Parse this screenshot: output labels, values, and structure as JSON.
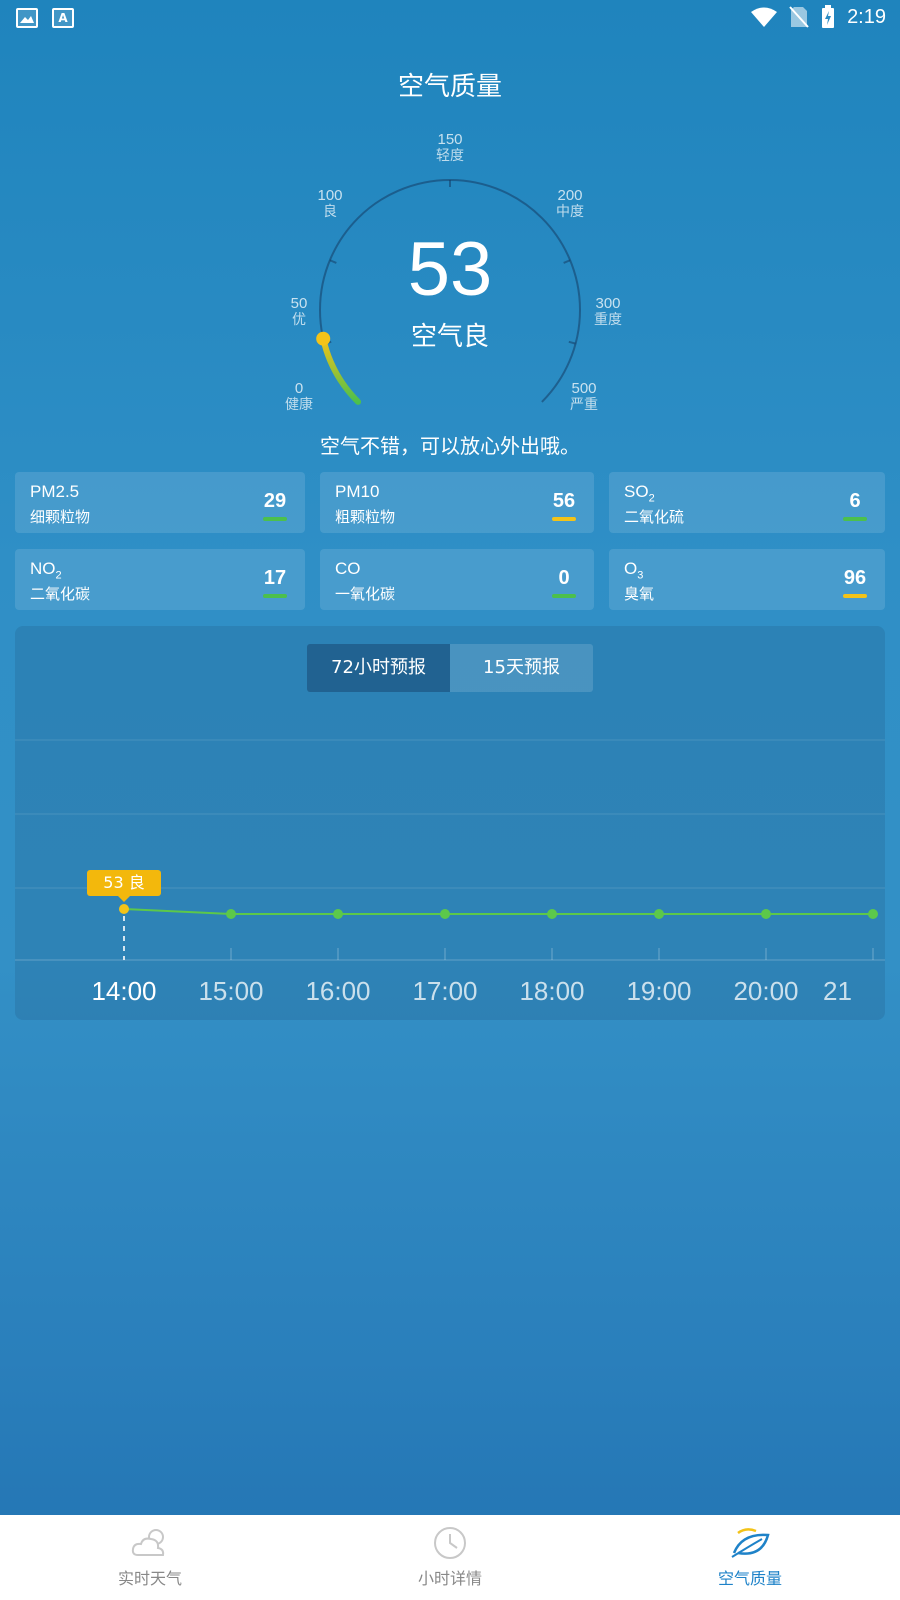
{
  "status_bar": {
    "time": "2:19",
    "app_icon_letter": "A"
  },
  "page": {
    "title": "空气质量"
  },
  "gauge": {
    "aqi": "53",
    "aqi_value": 53,
    "level": "空气良",
    "ticks": [
      {
        "value": "0",
        "label": "健康"
      },
      {
        "value": "50",
        "label": "优"
      },
      {
        "value": "100",
        "label": "良"
      },
      {
        "value": "150",
        "label": "轻度"
      },
      {
        "value": "200",
        "label": "中度"
      },
      {
        "value": "300",
        "label": "重度"
      },
      {
        "value": "500",
        "label": "严重"
      }
    ]
  },
  "advice": "空气不错，可以放心外出哦。",
  "pollutants": [
    {
      "name": "PM2.5",
      "sub": "",
      "cn": "细颗粒物",
      "value": "29",
      "color": "#4cc04c"
    },
    {
      "name": "PM10",
      "sub": "",
      "cn": "粗颗粒物",
      "value": "56",
      "color": "#f3c318"
    },
    {
      "name": "SO",
      "sub": "2",
      "cn": "二氧化硫",
      "value": "6",
      "color": "#4cc04c"
    },
    {
      "name": "NO",
      "sub": "2",
      "cn": "二氧化碳",
      "value": "17",
      "color": "#4cc04c"
    },
    {
      "name": "CO",
      "sub": "",
      "cn": "一氧化碳",
      "value": "0",
      "color": "#4cc04c"
    },
    {
      "name": "O",
      "sub": "3",
      "cn": "臭氧",
      "value": "96",
      "color": "#f3c318"
    }
  ],
  "forecast": {
    "tabs": [
      {
        "label": "72小时预报",
        "active": true
      },
      {
        "label": "15天预报",
        "active": false
      }
    ],
    "current_tag": "53 良",
    "hours": [
      "14:00",
      "15:00",
      "16:00",
      "17:00",
      "18:00",
      "19:00",
      "20:00",
      "21"
    ],
    "colors": {
      "line": "#5cc84a",
      "current": "#f3c318"
    }
  },
  "bottom_nav": [
    {
      "label": "实时天气",
      "icon": "cloud-sun-icon",
      "active": false
    },
    {
      "label": "小时详情",
      "icon": "clock-icon",
      "active": false
    },
    {
      "label": "空气质量",
      "icon": "leaf-icon",
      "active": true
    }
  ]
}
